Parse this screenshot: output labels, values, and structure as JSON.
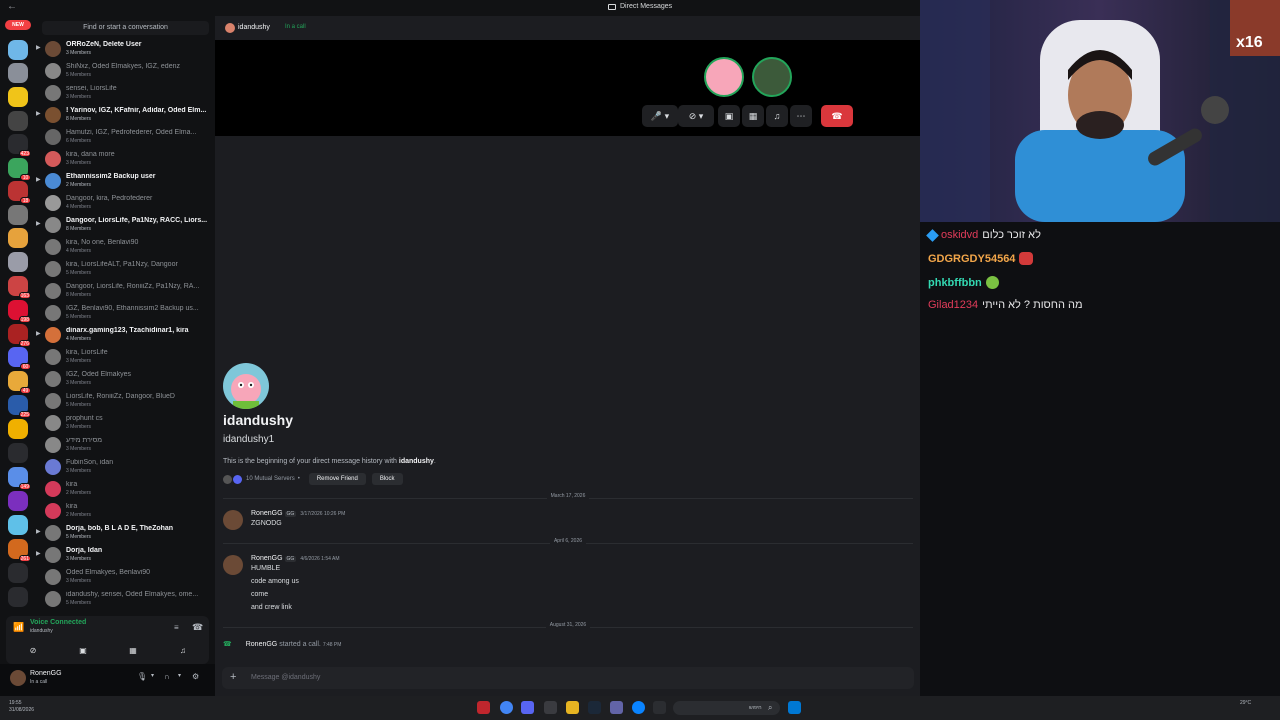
{
  "titlebar": {
    "back": "←",
    "title": "Direct Messages"
  },
  "rail": {
    "new_label": "NEW",
    "servers": [
      {
        "color": "#6fb7e8",
        "badge": ""
      },
      {
        "color": "#8a8f99",
        "badge": ""
      },
      {
        "color": "#f0c419",
        "badge": ""
      },
      {
        "color": "#444",
        "badge": ""
      },
      {
        "color": "#2a2b2f",
        "badge": "423"
      },
      {
        "color": "#3ba55d",
        "badge": "10"
      },
      {
        "color": "#b33",
        "badge": "18"
      },
      {
        "color": "#777",
        "badge": ""
      },
      {
        "color": "#e6a23c",
        "badge": ""
      },
      {
        "color": "#9a9ca8",
        "badge": ""
      },
      {
        "color": "#c44",
        "badge": "163"
      },
      {
        "color": "#d13",
        "badge": "198"
      },
      {
        "color": "#a22",
        "badge": "276"
      },
      {
        "color": "#5865f2",
        "badge": "60"
      },
      {
        "color": "#e8a93a",
        "badge": "49"
      },
      {
        "color": "#2a5caa",
        "badge": "225"
      },
      {
        "color": "#f0b000",
        "badge": ""
      },
      {
        "color": "#2a2b2f",
        "badge": ""
      },
      {
        "color": "#5a8ee8",
        "badge": "149"
      },
      {
        "color": "#7b2fbe",
        "badge": ""
      },
      {
        "color": "#5fc0e8",
        "badge": ""
      },
      {
        "color": "#d2691e",
        "badge": "261"
      },
      {
        "color": "#2a2b2f",
        "badge": ""
      },
      {
        "color": "#2a2b2f",
        "badge": ""
      }
    ]
  },
  "dms": {
    "search_placeholder": "Find or start a conversation",
    "items": [
      {
        "name": "ORRoZeN, Delete User",
        "members": "3 Members",
        "unread": true,
        "color": "#6b4a36"
      },
      {
        "name": "ShiNxz, Oded Elmakyes, IGZ, edenz",
        "members": "5 Members",
        "unread": false,
        "color": "#888"
      },
      {
        "name": "sensei, LiorsLife",
        "members": "3 Members",
        "unread": false,
        "color": "#777"
      },
      {
        "name": "! Yarinov, IGZ, KFafnir, Adidar, Oded Elm...",
        "members": "8 Members",
        "unread": true,
        "color": "#7a5030"
      },
      {
        "name": "Hamutzi, IGZ, Pedrofederer, Oded Elma...",
        "members": "6 Members",
        "unread": false,
        "color": "#666"
      },
      {
        "name": "kira, dana more",
        "members": "3 Members",
        "unread": false,
        "color": "#d45a5a"
      },
      {
        "name": "Ethannissim2 Backup user",
        "members": "2 Members",
        "unread": true,
        "color": "#4a8ad4"
      },
      {
        "name": "Dangoor, kira, Pedrofederer",
        "members": "4 Members",
        "unread": false,
        "color": "#999"
      },
      {
        "name": "Dangoor, LiorsLife, Pa1Nzy, RACC, Liors...",
        "members": "8 Members",
        "unread": true,
        "color": "#888"
      },
      {
        "name": "kira, No one, Benlavi90",
        "members": "4 Members",
        "unread": false,
        "color": "#777"
      },
      {
        "name": "kira, LiorsLifeALT, Pa1Nzy, Dangoor",
        "members": "5 Members",
        "unread": false,
        "color": "#777"
      },
      {
        "name": "Dangoor, LiorsLife, RoniiiZz, Pa1Nzy, RA...",
        "members": "8 Members",
        "unread": false,
        "color": "#777"
      },
      {
        "name": "IGZ, Benlavi90, Ethannissim2 Backup us...",
        "members": "5 Members",
        "unread": false,
        "color": "#777"
      },
      {
        "name": "dinarx.gaming123, Tzachidinar1, kira",
        "members": "4 Members",
        "unread": true,
        "color": "#d4703a"
      },
      {
        "name": "kira, LiorsLife",
        "members": "3 Members",
        "unread": false,
        "color": "#777"
      },
      {
        "name": "IGZ, Oded Elmakyes",
        "members": "3 Members",
        "unread": false,
        "color": "#777"
      },
      {
        "name": "LiorsLife, RoniiiZz, Dangoor, BlueD",
        "members": "5 Members",
        "unread": false,
        "color": "#777"
      },
      {
        "name": "prophunt cs",
        "members": "3 Members",
        "unread": false,
        "color": "#888"
      },
      {
        "name": "מסירת מידע",
        "members": "3 Members",
        "unread": false,
        "color": "#888"
      },
      {
        "name": "FubinSon, idan",
        "members": "3 Members",
        "unread": false,
        "color": "#6a7ad4"
      },
      {
        "name": "kira",
        "members": "2 Members",
        "unread": false,
        "color": "#d43a5a"
      },
      {
        "name": "kira",
        "members": "2 Members",
        "unread": false,
        "color": "#d43a5a"
      },
      {
        "name": "Dorja, bob, B L A D E, TheZohan",
        "members": "5 Members",
        "unread": true,
        "color": "#777"
      },
      {
        "name": "Dorja, Idan",
        "members": "3 Members",
        "unread": true,
        "color": "#777"
      },
      {
        "name": "Oded Elmakyes, Benlavi90",
        "members": "3 Members",
        "unread": false,
        "color": "#777"
      },
      {
        "name": "idandushy, sensei, Oded Elmakyes, ome...",
        "members": "5 Members",
        "unread": false,
        "color": "#777"
      }
    ]
  },
  "voice": {
    "status": "Voice Connected",
    "sub": "idandushy"
  },
  "user": {
    "name": "RonenGG",
    "status": "In a call"
  },
  "header": {
    "name": "idandushy",
    "call": "In a call"
  },
  "intro": {
    "display_name": "idandushy",
    "username": "idandushy1",
    "desc_prefix": "This is the beginning of your direct message history with ",
    "desc_name": "idandushy",
    "desc_suffix": ".",
    "mutual": "10 Mutual Servers",
    "sep": "•",
    "remove_friend": "Remove Friend",
    "block": "Block"
  },
  "messages": {
    "d1": "March 17, 2026",
    "m1": {
      "author": "RonenGG",
      "tag": "GG",
      "time": "3/17/2026 10:26 PM",
      "lines": [
        "ZGNODG"
      ]
    },
    "d2": "April 6, 2026",
    "m2": {
      "author": "RonenGG",
      "tag": "GG",
      "time": "4/6/2026 1:54 AM",
      "lines": [
        "HUMBLE",
        "code among us",
        "come",
        "and crew link"
      ]
    },
    "d3": "August 31, 2026",
    "call": {
      "author": "RonenGG",
      "text": "started a call.",
      "time": "7:48 PM"
    }
  },
  "composer": {
    "placeholder": "Message @idandushy"
  },
  "chat": [
    {
      "user": "oskidvd",
      "color": "#e23c5a",
      "text": "לא זוכר כלום"
    },
    {
      "user": "GDGRGDY54564",
      "color": "#f2a64a",
      "text": ""
    },
    {
      "user": "phkbffbbn",
      "color": "#33d9b2",
      "text": ""
    },
    {
      "user": "Gilad1234",
      "color": "#e23c5a",
      "text": "מה החסות ? לא הייתי"
    }
  ],
  "webcam": {
    "overlay": "x16"
  },
  "taskbar": {
    "time": "19:55",
    "date": "31/08/2026",
    "search": "חיפוש",
    "temp": "29°C"
  }
}
